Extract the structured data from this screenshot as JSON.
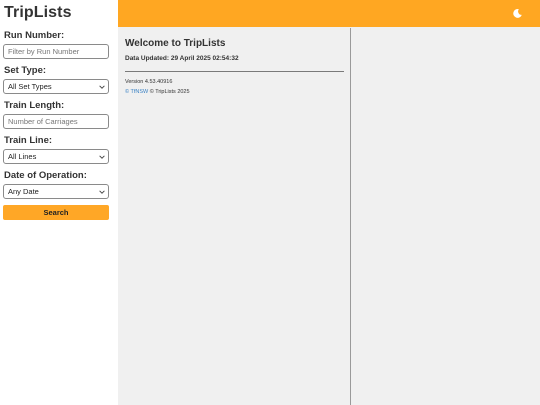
{
  "app": {
    "title": "TripLists"
  },
  "filters": {
    "run_number": {
      "label": "Run Number:",
      "placeholder": "Filter by Run Number",
      "value": ""
    },
    "set_type": {
      "label": "Set Type:",
      "selected": "All Set Types"
    },
    "train_length": {
      "label": "Train Length:",
      "placeholder": "Number of Carriages",
      "value": ""
    },
    "train_line": {
      "label": "Train Line:",
      "selected": "All Lines"
    },
    "date": {
      "label": "Date of Operation:",
      "selected": "Any Date"
    },
    "search_label": "Search"
  },
  "topbar": {
    "theme_icon": "moon-icon"
  },
  "main": {
    "welcome": "Welcome to TripLists",
    "updated": "Data Updated: 29 April 2025 02:54:32",
    "version": "Version 4.53.40916",
    "credit_link": "© TfNSW",
    "credit_rest": " © TripLists 2025"
  },
  "colors": {
    "accent": "#ffa722",
    "link": "#3b82c4",
    "background": "#f0f0f0"
  }
}
